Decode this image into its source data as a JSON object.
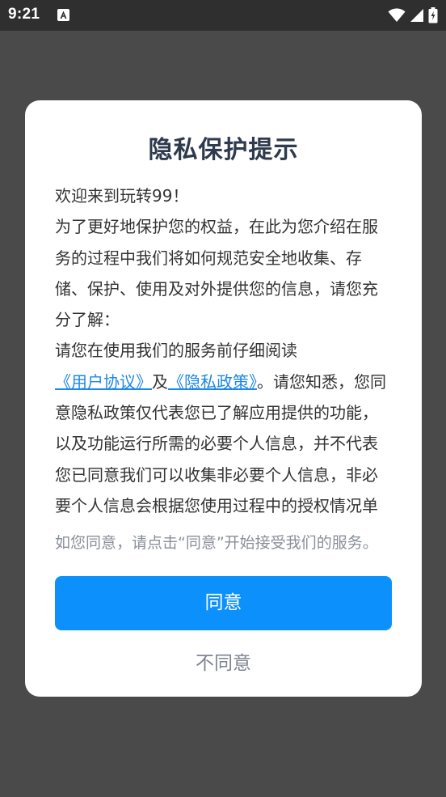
{
  "status_bar": {
    "time": "9:21",
    "notification_icon": "a-notification-icon",
    "wifi_icon": "wifi-icon",
    "signal_icon": "cellular-signal-icon",
    "battery_icon": "battery-charging-icon"
  },
  "dialog": {
    "title": "隐私保护提示",
    "paragraphs": {
      "welcome": "欢迎来到玩转99！",
      "intro": "为了更好地保护您的权益，在此为您介绍在服务的过程中我们将如何规范安全地收集、存储、保护、使用及对外提供您的信息，请您充分了解：",
      "read_prefix": "请您在使用我们的服务前仔细阅读",
      "user_agreement_link": "《用户协议》",
      "and": "及",
      "privacy_policy_link": "《隐私政策》",
      "read_suffix": "。请您知悉，您同意隐私政策仅代表您已了解应用提供的功能，以及功能运行所需的必要个人信息，并不代表您已同意我们可以收集非必要个人信息，非必要个人信息会根据您使用过程中的授权情况单独征求"
    },
    "hint": "如您同意，请点击“同意”开始接受我们的服务。",
    "agree_label": "同意",
    "disagree_label": "不同意"
  },
  "colors": {
    "overlay": "#4a4a4a",
    "status_bar": "#2f2f2f",
    "title": "#2e3a4d",
    "link": "#1e88e5",
    "primary_button": "#0c91fc",
    "secondary_text": "#7d8591"
  }
}
